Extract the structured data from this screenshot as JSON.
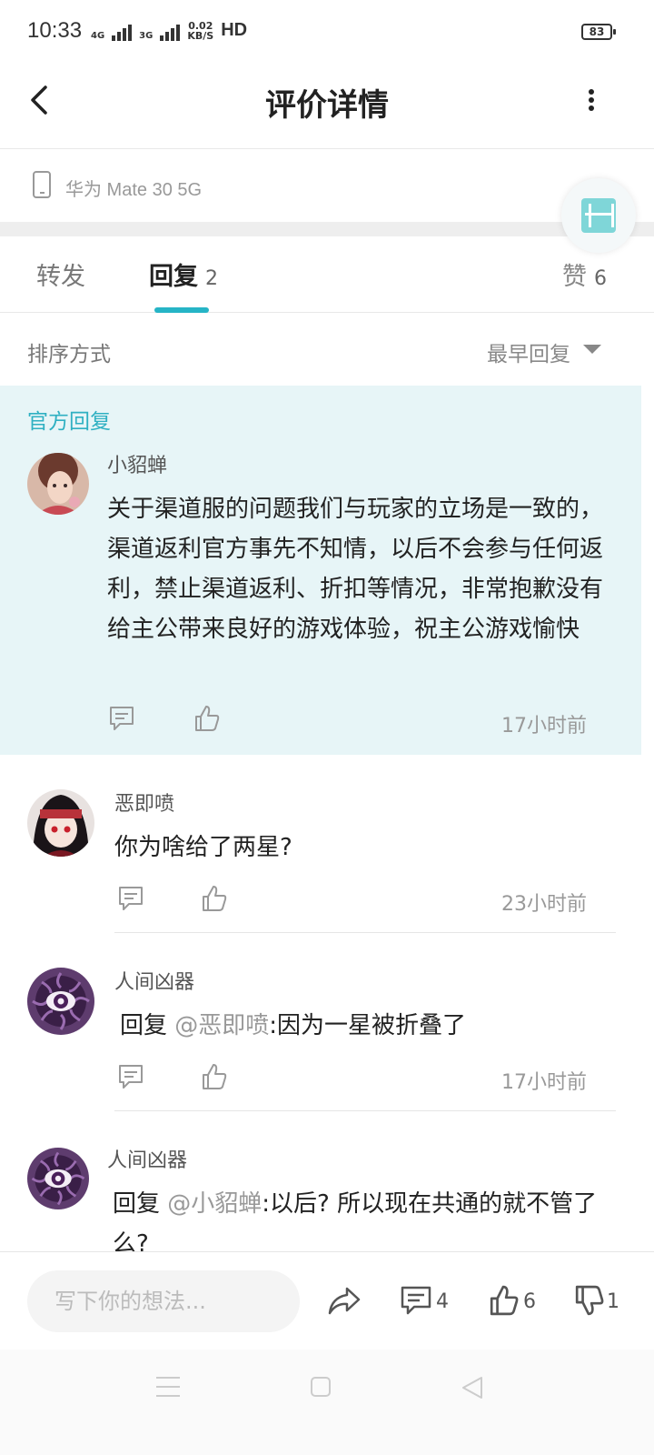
{
  "status_bar": {
    "time": "10:33",
    "net1": "4G",
    "net2": "3G",
    "speed_value": "0.02",
    "speed_unit": "KB/S",
    "hd": "HD",
    "battery": "83"
  },
  "header": {
    "title": "评价详情",
    "back_icon": "chevron-left-icon",
    "more_icon": "more-vertical-icon"
  },
  "device": {
    "name": "华为 Mate 30 5G",
    "icon": "phone-icon"
  },
  "tabs": {
    "forward": {
      "label": "转发"
    },
    "reply": {
      "label": "回复",
      "count": "2"
    },
    "like": {
      "label": "赞",
      "count": "6"
    }
  },
  "sort": {
    "label": "排序方式",
    "value": "最早回复"
  },
  "official": {
    "tag": "官方回复",
    "user": "小貂蝉",
    "text": "关于渠道服的问题我们与玩家的立场是一致的，渠道返利官方事先不知情，以后不会参与任何返利，禁止渠道返利、折扣等情况，非常抱歉没有给主公带来良好的游戏体验，祝主公游戏愉快",
    "time": "17小时前"
  },
  "comments": [
    {
      "user": "恶即喷",
      "text": "你为啥给了两星?",
      "time": "23小时前"
    },
    {
      "user": "人间凶器",
      "reply_prefix": "回复",
      "mention": "@恶即喷",
      "text": ":因为一星被折叠了",
      "time": "17小时前"
    },
    {
      "user": "人间凶器",
      "reply_prefix": "回复",
      "mention": "@小貂蝉",
      "text": ":以后? 所以现在共通的就不管了么?"
    }
  ],
  "bottom_bar": {
    "placeholder": "写下你的想法...",
    "comment_count": "4",
    "like_count": "6",
    "dislike_count": "1"
  },
  "colors": {
    "accent": "#26b4c6",
    "official_bg": "#e7f5f7",
    "official_tag": "#2fb0c2"
  }
}
